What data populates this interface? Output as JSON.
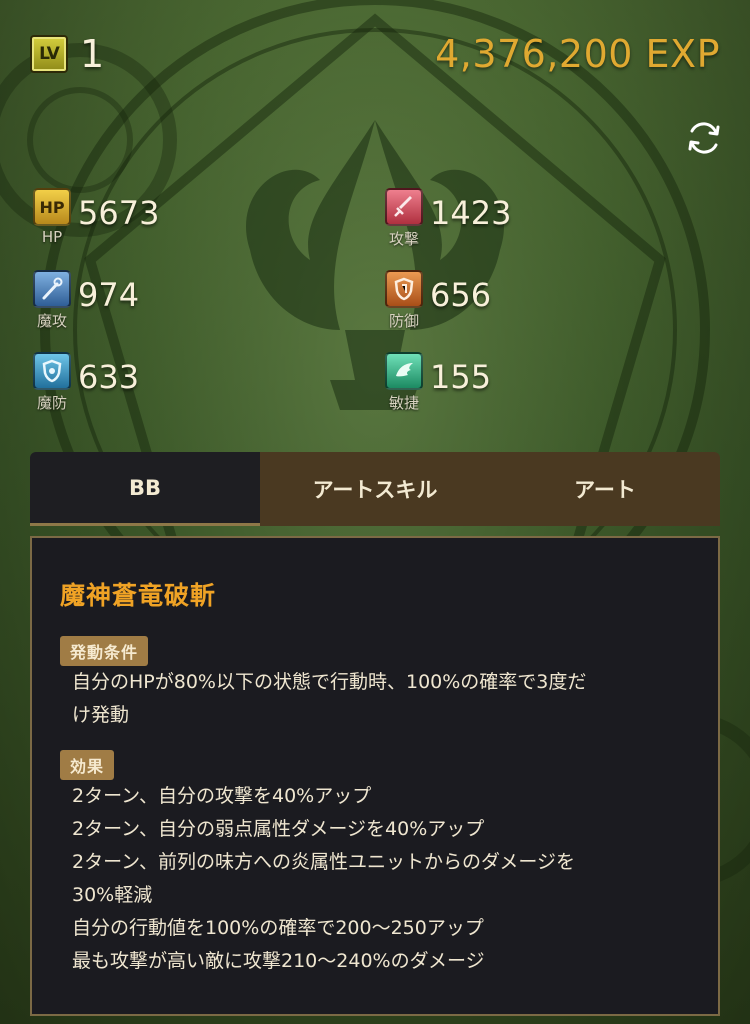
{
  "header": {
    "lv_icon_text": "LV",
    "level": "1",
    "exp": "4,376,200 EXP"
  },
  "icons": {
    "refresh": "refresh-icon"
  },
  "stats": [
    {
      "key": "hp",
      "icon_text": "HP",
      "label": "HP",
      "value": "5673",
      "color": "#e0b429"
    },
    {
      "key": "attack",
      "label": "攻撃",
      "value": "1423",
      "color": "#d0485a"
    },
    {
      "key": "magic_attack",
      "label": "魔攻",
      "value": "974",
      "color": "#4a7fb8"
    },
    {
      "key": "defense",
      "label": "防御",
      "value": "656",
      "color": "#c8682a"
    },
    {
      "key": "magic_defense",
      "label": "魔防",
      "value": "633",
      "color": "#3a8fb8"
    },
    {
      "key": "agility",
      "label": "敏捷",
      "value": "155",
      "color": "#2fb488"
    }
  ],
  "tabs": [
    {
      "label": "BB",
      "active": true
    },
    {
      "label": "アートスキル",
      "active": false
    },
    {
      "label": "アート",
      "active": false
    }
  ],
  "skill": {
    "name": "魔神蒼竜破斬",
    "condition_tag": "発動条件",
    "condition_lines": [
      "自分のHPが80%以下の状態で行動時、100%の確率で3度だ",
      "け発動"
    ],
    "effect_tag": "効果",
    "effect_lines": [
      "2ターン、自分の攻撃を40%アップ",
      "2ターン、自分の弱点属性ダメージを40%アップ",
      "2ターン、前列の味方への炎属性ユニットからのダメージを",
      "30%軽減",
      "自分の行動値を100%の確率で200〜250アップ",
      "最も攻撃が高い敵に攻撃210〜240%のダメージ"
    ]
  },
  "colors": {
    "exp": "#e0a931",
    "skill_title": "#f0a325",
    "tag_bg": "#a07c45",
    "panel_bg": "#1b1b20",
    "tab_inactive_bg": "#4a3921"
  }
}
